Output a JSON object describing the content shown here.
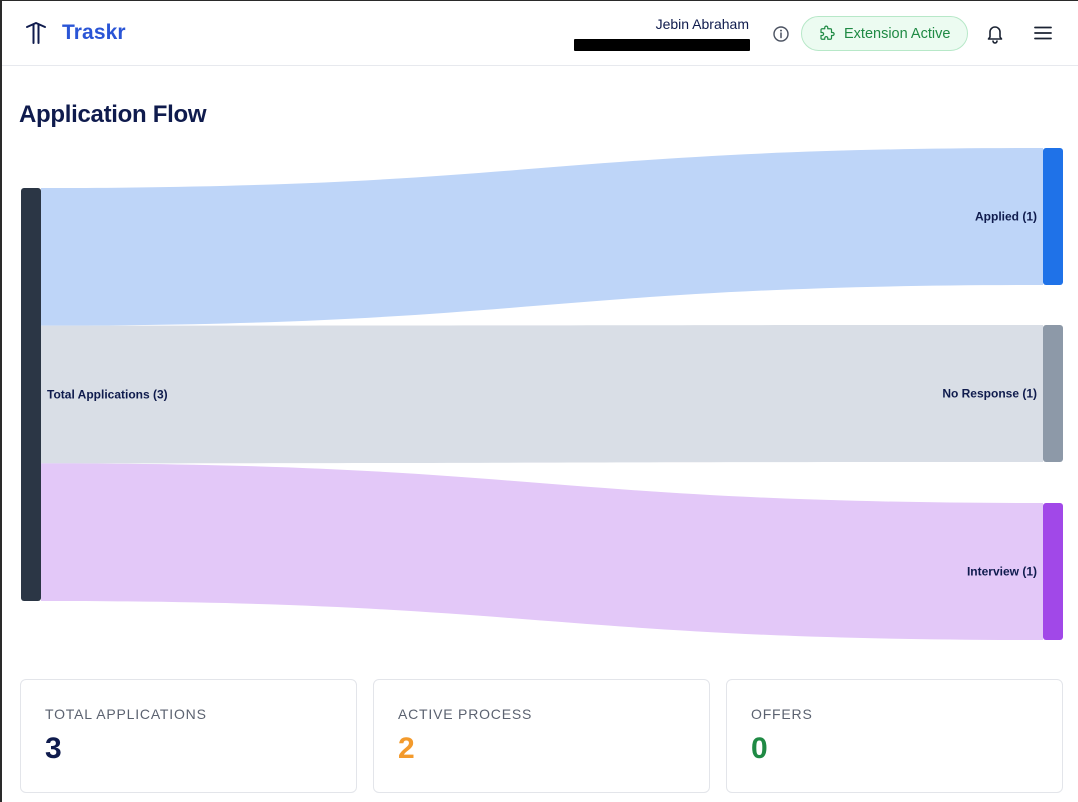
{
  "header": {
    "brand": "Traskr",
    "user_name": "Jebin Abraham",
    "extension_label": "Extension Active"
  },
  "page": {
    "title": "Application Flow"
  },
  "chart_data": {
    "type": "sankey",
    "source": {
      "name": "Total Applications",
      "label": "Total Applications (3)",
      "value": 3,
      "color": "#2b3645"
    },
    "targets": [
      {
        "name": "Applied",
        "label": "Applied (1)",
        "value": 1,
        "color": "#1f72e8",
        "link_color": "#bed5f8"
      },
      {
        "name": "No Response",
        "label": "No Response (1)",
        "value": 1,
        "color": "#8d99a8",
        "link_color": "#d9dee6"
      },
      {
        "name": "Interview",
        "label": "Interview (1)",
        "value": 1,
        "color": "#a148e8",
        "link_color": "#e3c8f8"
      }
    ]
  },
  "stats": [
    {
      "label": "TOTAL APPLICATIONS",
      "value": "3",
      "color": "#0f1b4d"
    },
    {
      "label": "ACTIVE PROCESS",
      "value": "2",
      "color": "#f39a2c"
    },
    {
      "label": "OFFERS",
      "value": "0",
      "color": "#1f8a44"
    }
  ]
}
